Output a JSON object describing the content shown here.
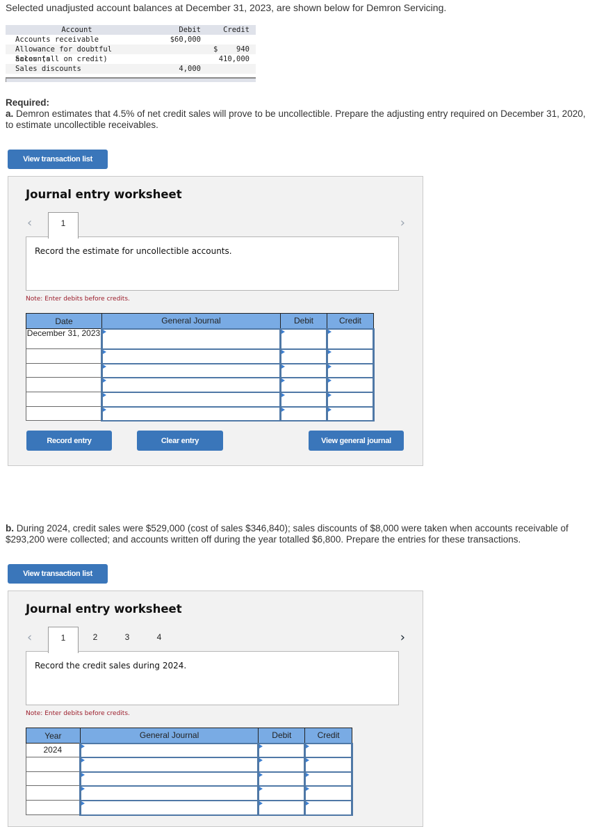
{
  "intro": "Selected unadjusted account balances at December 31, 2023, are shown below for Demron Servicing.",
  "balances": {
    "headers": {
      "account": "Account",
      "debit": "Debit",
      "credit": "Credit"
    },
    "rows": [
      {
        "account": "Accounts receivable",
        "debit": "$60,000",
        "credit_sym": "",
        "credit": ""
      },
      {
        "account": "Allowance for doubtful accounts",
        "debit": "",
        "credit_sym": "$",
        "credit": "940"
      },
      {
        "account": "Sales (all on credit)",
        "debit": "",
        "credit_sym": "",
        "credit": "410,000"
      },
      {
        "account": "Sales discounts",
        "debit": "4,000",
        "credit_sym": "",
        "credit": ""
      }
    ]
  },
  "required": {
    "label": "Required:",
    "part_a_prefix": "a.",
    "part_a_text": " Demron estimates that 4.5% of net credit sales will prove to be uncollectible. Prepare the adjusting entry required on December 31, 2020, to estimate uncollectible receivables.",
    "part_b_prefix": "b.",
    "part_b_text": " During 2024, credit sales were $529,000 (cost of sales $346,840); sales discounts of $8,000 were taken when accounts receivable of $293,200 were collected; and accounts written off during the year totalled $6,800. Prepare the entries for these transactions."
  },
  "buttons": {
    "view_transaction_list": "View transaction list",
    "record_entry": "Record entry",
    "clear_entry": "Clear entry",
    "view_general_journal": "View general journal"
  },
  "worksheet_a": {
    "title": "Journal entry worksheet",
    "prev_icon": "‹",
    "next_icon": "›",
    "tabs": [
      "1"
    ],
    "active_tab": "1",
    "instruction": "Record the estimate for uncollectible accounts.",
    "note": "Note: Enter debits before credits.",
    "columns": [
      "Date",
      "General Journal",
      "Debit",
      "Credit"
    ],
    "rows": [
      {
        "date": "December 31, 2023",
        "account": "",
        "debit": "",
        "credit": ""
      },
      {
        "date": "",
        "account": "",
        "debit": "",
        "credit": ""
      },
      {
        "date": "",
        "account": "",
        "debit": "",
        "credit": ""
      },
      {
        "date": "",
        "account": "",
        "debit": "",
        "credit": ""
      },
      {
        "date": "",
        "account": "",
        "debit": "",
        "credit": ""
      },
      {
        "date": "",
        "account": "",
        "debit": "",
        "credit": ""
      }
    ]
  },
  "worksheet_b": {
    "title": "Journal entry worksheet",
    "prev_icon": "‹",
    "next_icon": "›",
    "tabs": [
      "1",
      "2",
      "3",
      "4"
    ],
    "active_tab": "1",
    "instruction": "Record the credit sales during 2024.",
    "note": "Note: Enter debits before credits.",
    "columns": [
      "Year",
      "General Journal",
      "Debit",
      "Credit"
    ],
    "rows": [
      {
        "date": "2024",
        "account": "",
        "debit": "",
        "credit": ""
      },
      {
        "date": "",
        "account": "",
        "debit": "",
        "credit": ""
      },
      {
        "date": "",
        "account": "",
        "debit": "",
        "credit": ""
      },
      {
        "date": "",
        "account": "",
        "debit": "",
        "credit": ""
      },
      {
        "date": "",
        "account": "",
        "debit": "",
        "credit": ""
      }
    ]
  }
}
